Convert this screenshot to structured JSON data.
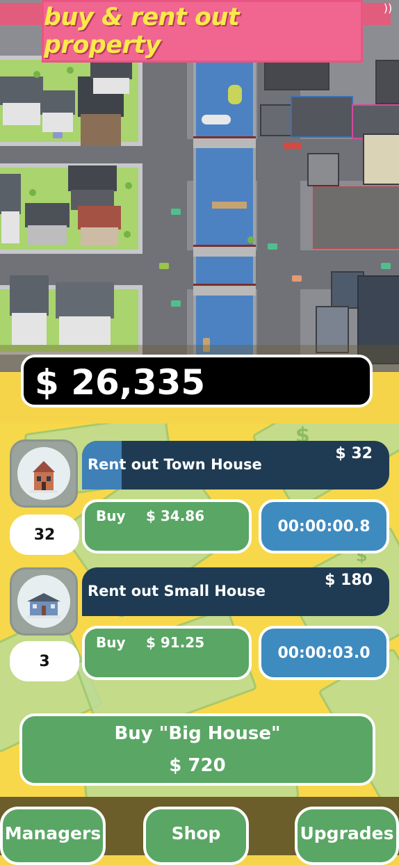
{
  "title": "buy & rent out property",
  "money": "$ 26,335",
  "properties": [
    {
      "rent_label": "Rent out Town House",
      "rent_amount": "$ 32",
      "progress": 0.13,
      "count": "32",
      "buy_label": "Buy",
      "buy_price": "$ 34.86",
      "timer": "00:00:00.8",
      "icon": "town-house-icon"
    },
    {
      "rent_label": "Rent out Small House",
      "rent_amount": "$ 180",
      "progress": 0.0,
      "count": "3",
      "buy_label": "Buy",
      "buy_price": "$ 91.25",
      "timer": "00:00:03.0",
      "icon": "small-house-icon"
    }
  ],
  "big_house": {
    "line1": "Buy \"Big House\"",
    "line2": "$ 720"
  },
  "nav": {
    "managers": "Managers",
    "shop": "Shop",
    "upgrades": "Upgrades"
  },
  "colors": {
    "panel": "#f7d84b",
    "button_green": "#5aa665",
    "timer_blue": "#3e8bc0",
    "rent_dark": "#1f3b54",
    "banner_pink": "#f06690",
    "banner_text": "#fbe94a"
  }
}
